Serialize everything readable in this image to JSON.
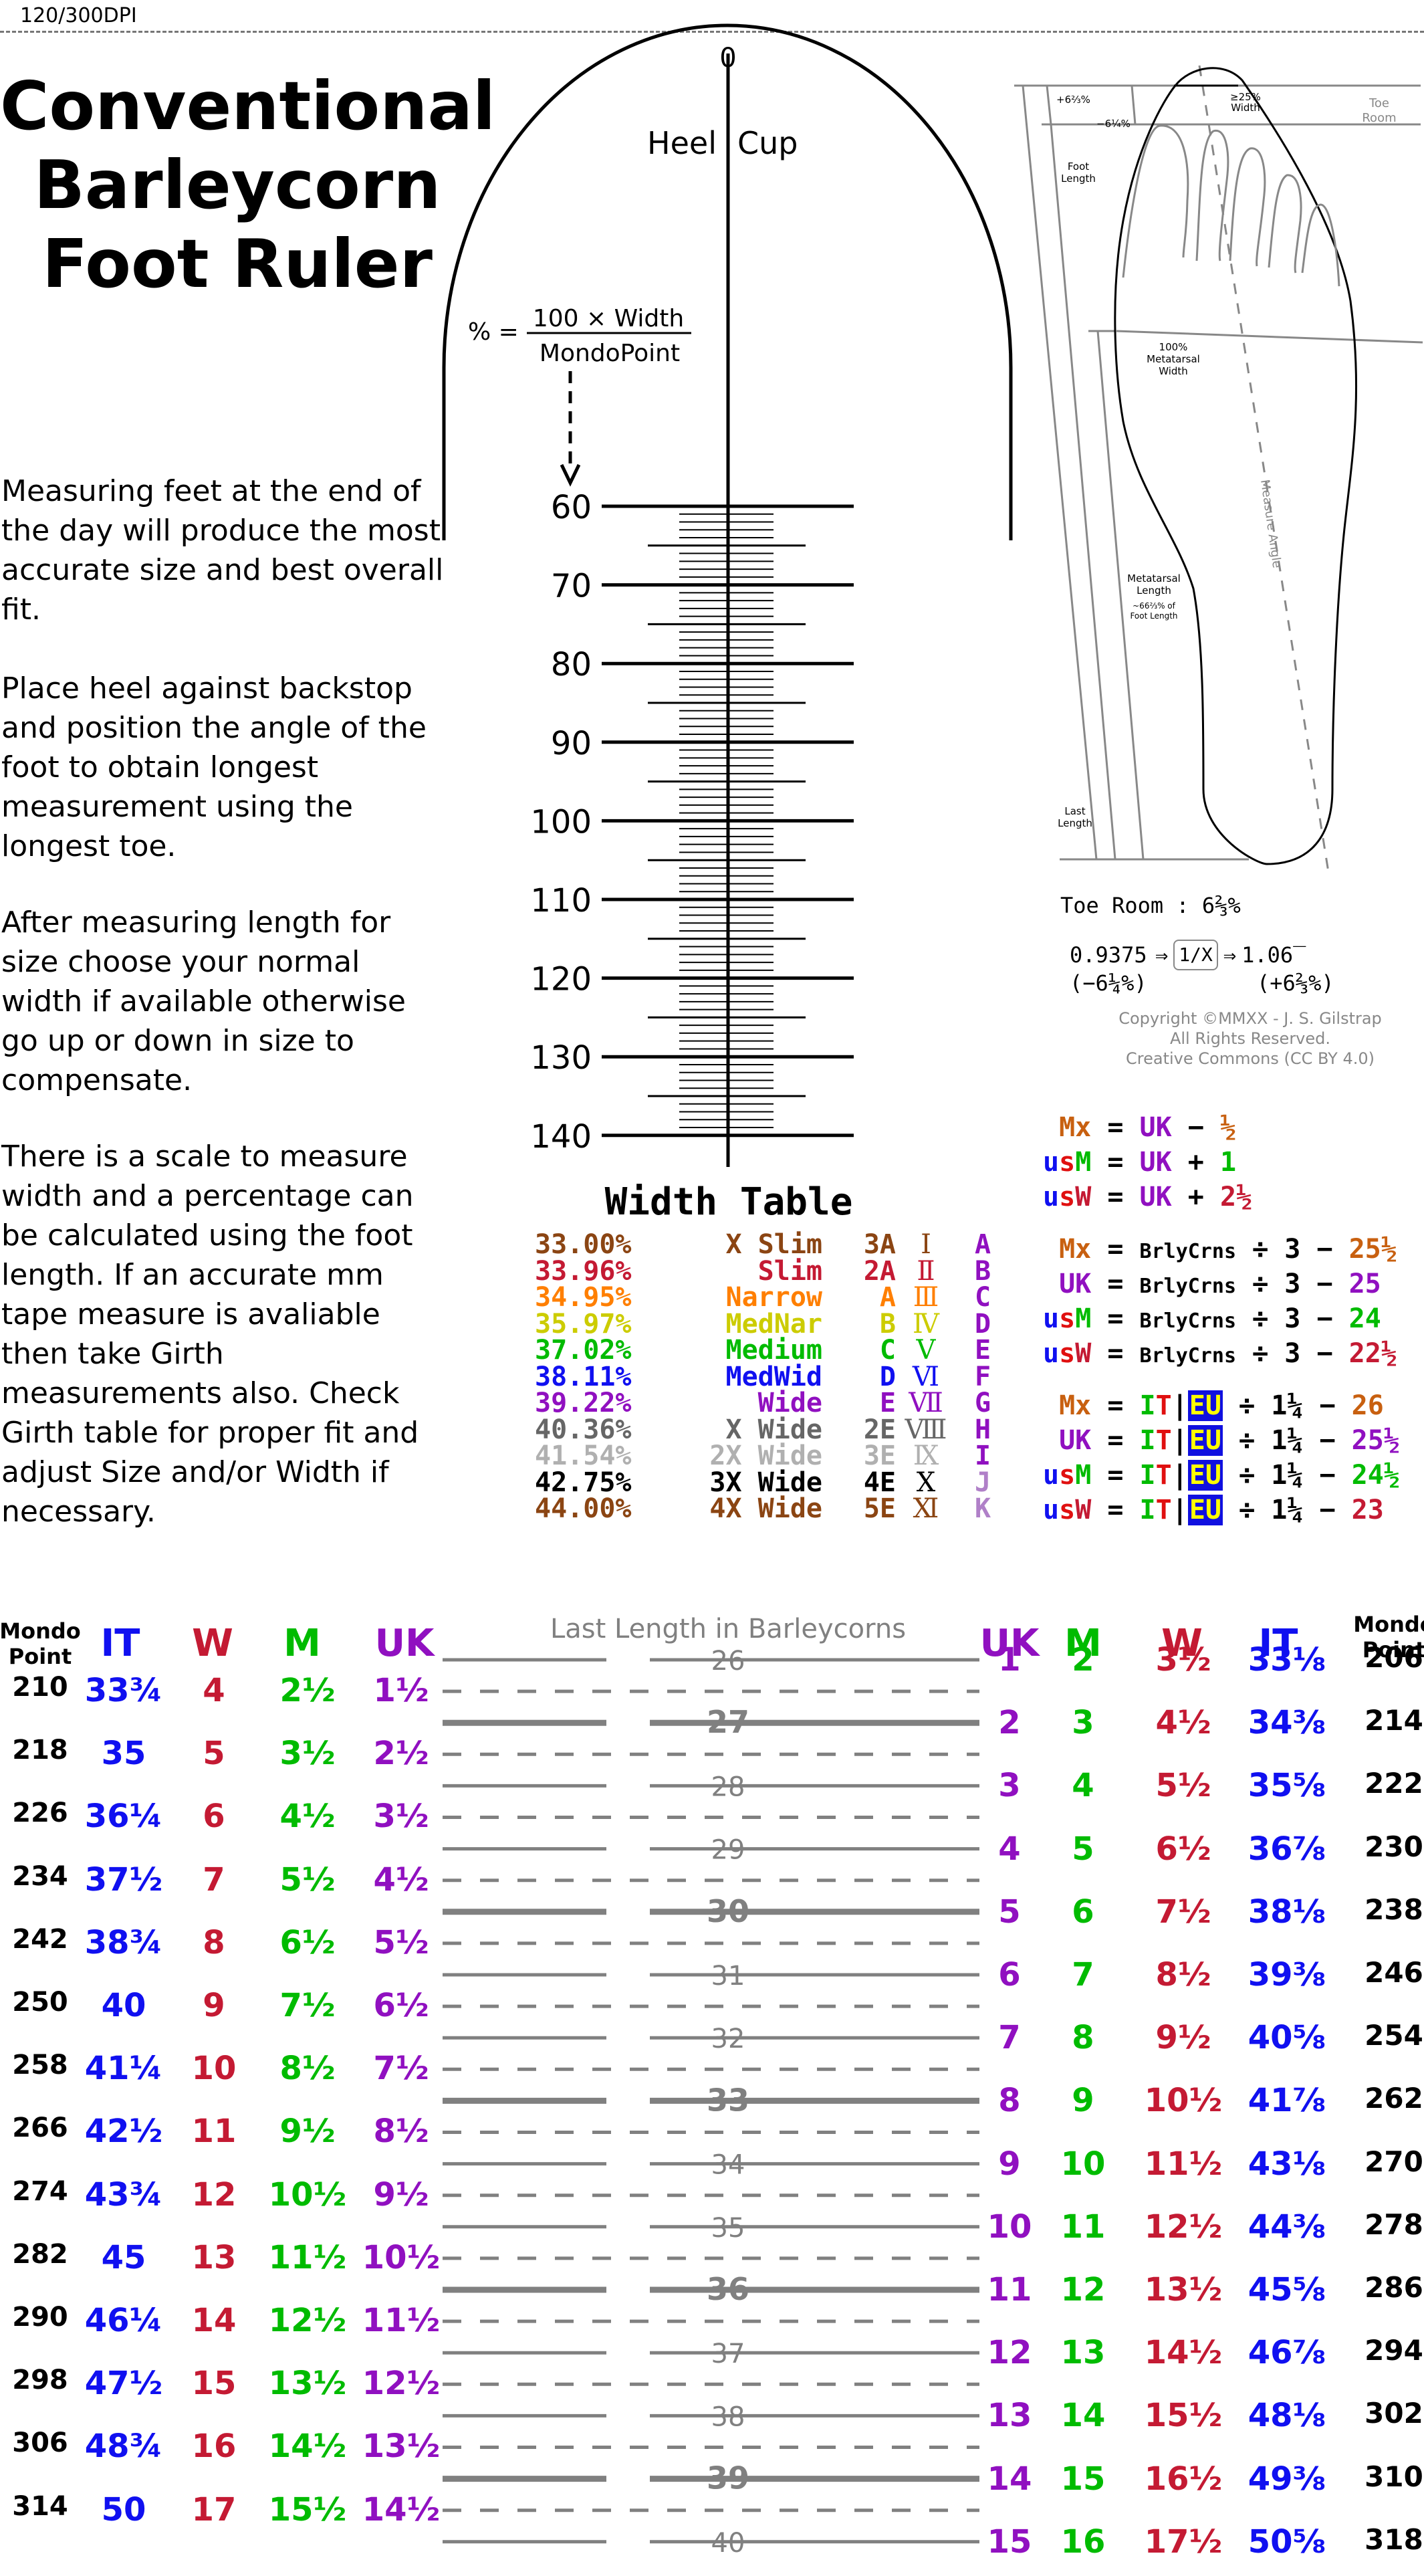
{
  "header": {
    "dpi_label": "120/300DPI"
  },
  "title": {
    "line1": "Conventional",
    "line2": "Barleycorn",
    "line3": "Foot Ruler"
  },
  "instructions": [
    "Measuring feet at the end of the day will produce the most accurate size and best overall fit.",
    "Place heel against backstop and position the angle of the foot to obtain longest measurement using the longest toe.",
    "After measuring length for size choose your normal width if available otherwise go up or down in size to compensate.",
    "There is a scale to measure width and a percentage can be calculated using the foot length.  If an accurate mm tape measure is avaliable then take Girth measurements also.  Check Girth table for proper fit and adjust Size and/or Width if necessary."
  ],
  "ruler": {
    "zero_label": "0",
    "heel_label": "Heel",
    "cup_label": "Cup",
    "formula_lhs": "% =",
    "formula_num": "100 × Width",
    "formula_den": "MondoPoint",
    "major_ticks": [
      "60",
      "70",
      "80",
      "90",
      "100",
      "110",
      "120",
      "130",
      "140"
    ]
  },
  "foot_diagram": {
    "plus_pct": "+6⅔%",
    "minus_pct": "−6¼%",
    "toe_width": "≥25%",
    "toe_width2": "Width",
    "toe_room1": "Toe",
    "toe_room2": "Room",
    "foot_length1": "Foot",
    "foot_length2": "Length",
    "meta_width1": "100%",
    "meta_width2": "Metatarsal",
    "meta_width3": "Width",
    "measure_angle": "Measure Angle",
    "meta_length1": "Metatarsal",
    "meta_length2": "Length",
    "meta_length3": "~66⅔% of",
    "meta_length4": "Foot Length",
    "last_length1": "Last",
    "last_length2": "Length"
  },
  "toe_room": {
    "label": "Toe Room : 6⅔%",
    "calc_left": "0.9375",
    "calc_left_pct": "(−6¼%)",
    "calc_op": "1/X",
    "calc_right": "1.06̅",
    "calc_right_pct": "(+6⅔%)"
  },
  "copyright": {
    "line1": "Copyright ©MMXX - J. S. Gilstrap",
    "line2": "All Rights Reserved.",
    "line3": "Creative Commons (CC BY 4.0)"
  },
  "formulas": {
    "group1": [
      {
        "lhs": " Mx",
        "rhs": "UK − ",
        "const": "½"
      },
      {
        "lhs": "usM",
        "rhs": "UK + ",
        "const": "1"
      },
      {
        "lhs": "usW",
        "rhs": "UK + ",
        "const": "2½"
      }
    ],
    "group2": [
      {
        "lhs": " Mx",
        "const": "25½"
      },
      {
        "lhs": " UK",
        "const": "25"
      },
      {
        "lhs": "usM",
        "const": "24"
      },
      {
        "lhs": "usW",
        "const": "22½"
      }
    ],
    "group3": [
      {
        "lhs": " Mx",
        "const": "26"
      },
      {
        "lhs": " UK",
        "const": "25½"
      },
      {
        "lhs": "usM",
        "const": "24½"
      },
      {
        "lhs": "usW",
        "const": "23"
      }
    ],
    "brly": "BrlyCrns ÷ 3 −",
    "it": "IT",
    "eu": "EU",
    "div": "÷ 1¼ −"
  },
  "width_table": {
    "title": "Width Table",
    "rows": [
      {
        "pct": "33.00%",
        "name": "X Slim",
        "code": "3A",
        "roman": "Ⅰ",
        "letter": "A",
        "color": "#8b4513"
      },
      {
        "pct": "33.96%",
        "name": "Slim",
        "code": "2A",
        "roman": "Ⅱ",
        "letter": "B",
        "color": "#c41a33"
      },
      {
        "pct": "34.95%",
        "name": "Narrow",
        "code": "A",
        "roman": "Ⅲ",
        "letter": "C",
        "color": "#ff7f00"
      },
      {
        "pct": "35.97%",
        "name": "MedNar",
        "code": "B",
        "roman": "Ⅳ",
        "letter": "D",
        "color": "#cccc00"
      },
      {
        "pct": "37.02%",
        "name": "Medium",
        "code": "C",
        "roman": "Ⅴ",
        "letter": "E",
        "color": "#00bb00"
      },
      {
        "pct": "38.11%",
        "name": "MedWid",
        "code": "D",
        "roman": "Ⅵ",
        "letter": "F",
        "color": "#1010f0"
      },
      {
        "pct": "39.22%",
        "name": "Wide",
        "code": "E",
        "roman": "Ⅶ",
        "letter": "G",
        "color": "#9010c0"
      },
      {
        "pct": "40.36%",
        "name": "X Wide",
        "code": "2E",
        "roman": "Ⅷ",
        "letter": "H",
        "color": "#666666"
      },
      {
        "pct": "41.54%",
        "name": "2X Wide",
        "code": "3E",
        "roman": "Ⅸ",
        "letter": "I",
        "color": "#b0b0b0"
      },
      {
        "pct": "42.75%",
        "name": "3X Wide",
        "code": "4E",
        "roman": "Ⅹ",
        "letter": "J",
        "color": "#000000"
      },
      {
        "pct": "44.00%",
        "name": "4X Wide",
        "code": "5E",
        "roman": "Ⅺ",
        "letter": "K",
        "color": "#8b4513"
      }
    ],
    "letter_colors": [
      "#9010c0",
      "#9010c0",
      "#9010c0",
      "#9010c0",
      "#9010c0",
      "#9010c0",
      "#9010c0",
      "#9010c0",
      "#9010c0",
      "#b080c8",
      "#b080c8"
    ]
  },
  "colors": {
    "uk": "#9010c0",
    "m": "#00bb00",
    "w": "#c41a33",
    "it": "#1010f0",
    "mx": "#c86010",
    "us_u": "#1010f0",
    "us_s": "#e01010",
    "grey": "#808080"
  },
  "left_size_table": {
    "headers": {
      "mondo1": "Mondo",
      "mondo2": "Point",
      "it": "IT",
      "w": "W",
      "m": "M",
      "uk": "UK"
    },
    "rows": [
      {
        "mp": "210",
        "it": "33¾",
        "w": "4",
        "m": "2½",
        "uk": "1½"
      },
      {
        "mp": "218",
        "it": "35",
        "w": "5",
        "m": "3½",
        "uk": "2½"
      },
      {
        "mp": "226",
        "it": "36¼",
        "w": "6",
        "m": "4½",
        "uk": "3½"
      },
      {
        "mp": "234",
        "it": "37½",
        "w": "7",
        "m": "5½",
        "uk": "4½"
      },
      {
        "mp": "242",
        "it": "38¾",
        "w": "8",
        "m": "6½",
        "uk": "5½"
      },
      {
        "mp": "250",
        "it": "40",
        "w": "9",
        "m": "7½",
        "uk": "6½"
      },
      {
        "mp": "258",
        "it": "41¼",
        "w": "10",
        "m": "8½",
        "uk": "7½"
      },
      {
        "mp": "266",
        "it": "42½",
        "w": "11",
        "m": "9½",
        "uk": "8½"
      },
      {
        "mp": "274",
        "it": "43¾",
        "w": "12",
        "m": "10½",
        "uk": "9½"
      },
      {
        "mp": "282",
        "it": "45",
        "w": "13",
        "m": "11½",
        "uk": "10½"
      },
      {
        "mp": "290",
        "it": "46¼",
        "w": "14",
        "m": "12½",
        "uk": "11½"
      },
      {
        "mp": "298",
        "it": "47½",
        "w": "15",
        "m": "13½",
        "uk": "12½"
      },
      {
        "mp": "306",
        "it": "48¾",
        "w": "16",
        "m": "14½",
        "uk": "13½"
      },
      {
        "mp": "314",
        "it": "50",
        "w": "17",
        "m": "15½",
        "uk": "14½"
      }
    ]
  },
  "right_size_table": {
    "headers": {
      "uk": "UK",
      "m": "M",
      "w": "W",
      "it": "IT",
      "mondo1": "Mondo",
      "mondo2": "Point"
    },
    "rows": [
      {
        "uk": "1",
        "m": "2",
        "w": "3½",
        "it": "33⅛",
        "mp": "206"
      },
      {
        "uk": "2",
        "m": "3",
        "w": "4½",
        "it": "34⅜",
        "mp": "214"
      },
      {
        "uk": "3",
        "m": "4",
        "w": "5½",
        "it": "35⅝",
        "mp": "222"
      },
      {
        "uk": "4",
        "m": "5",
        "w": "6½",
        "it": "36⅞",
        "mp": "230"
      },
      {
        "uk": "5",
        "m": "6",
        "w": "7½",
        "it": "38⅛",
        "mp": "238"
      },
      {
        "uk": "6",
        "m": "7",
        "w": "8½",
        "it": "39⅜",
        "mp": "246"
      },
      {
        "uk": "7",
        "m": "8",
        "w": "9½",
        "it": "40⅝",
        "mp": "254"
      },
      {
        "uk": "8",
        "m": "9",
        "w": "10½",
        "it": "41⅞",
        "mp": "262"
      },
      {
        "uk": "9",
        "m": "10",
        "w": "11½",
        "it": "43⅛",
        "mp": "270"
      },
      {
        "uk": "10",
        "m": "11",
        "w": "12½",
        "it": "44⅜",
        "mp": "278"
      },
      {
        "uk": "11",
        "m": "12",
        "w": "13½",
        "it": "45⅝",
        "mp": "286"
      },
      {
        "uk": "12",
        "m": "13",
        "w": "14½",
        "it": "46⅞",
        "mp": "294"
      },
      {
        "uk": "13",
        "m": "14",
        "w": "15½",
        "it": "48⅛",
        "mp": "302"
      },
      {
        "uk": "14",
        "m": "15",
        "w": "16½",
        "it": "49⅜",
        "mp": "310"
      },
      {
        "uk": "15",
        "m": "16",
        "w": "17½",
        "it": "50⅝",
        "mp": "318"
      }
    ]
  },
  "barleycorn_scale": {
    "title": "Last Length in Barleycorns",
    "labels": [
      "26",
      "27",
      "28",
      "29",
      "30",
      "31",
      "32",
      "33",
      "34",
      "35",
      "36",
      "37",
      "38",
      "39",
      "40"
    ],
    "bold_labels": [
      "27",
      "30",
      "33",
      "36",
      "39"
    ]
  }
}
